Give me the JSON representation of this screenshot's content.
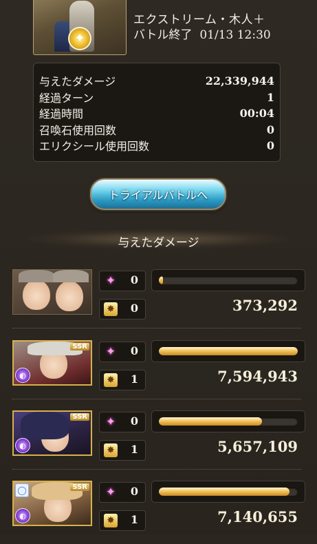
{
  "header": {
    "quest_title": "エクストリーム・木人＋",
    "battle_end_label": "バトル終了",
    "battle_end_time": "01/13 12:30",
    "boss_icon": "boss-portrait-icon",
    "element_icon": "light-element-icon"
  },
  "stats": [
    {
      "label": "与えたダメージ",
      "value": "22,339,944"
    },
    {
      "label": "経過ターン",
      "value": "1"
    },
    {
      "label": "経過時間",
      "value": "00:04"
    },
    {
      "label": "召喚石使用回数",
      "value": "0"
    },
    {
      "label": "エリクシール使用回数",
      "value": "0"
    }
  ],
  "trial_button_label": "トライアルバトルへ",
  "damage_section_title": "与えたダメージ",
  "characters": [
    {
      "skill_count": "0",
      "ca_count": "0",
      "damage": "373,292",
      "bar_fraction": 0.02,
      "rarity": "",
      "element": ""
    },
    {
      "skill_count": "0",
      "ca_count": "1",
      "damage": "7,594,943",
      "bar_fraction": 1.0,
      "rarity": "SSR",
      "element": "dark"
    },
    {
      "skill_count": "0",
      "ca_count": "1",
      "damage": "5,657,109",
      "bar_fraction": 0.745,
      "rarity": "SSR",
      "element": "dark"
    },
    {
      "skill_count": "0",
      "ca_count": "1",
      "damage": "7,140,655",
      "bar_fraction": 0.94,
      "rarity": "SSR",
      "element": "dark"
    }
  ],
  "icons": {
    "skill": "skill-sparkle-icon",
    "ca": "charge-attack-icon",
    "element": "dark-element-icon",
    "ring": "ring-icon"
  },
  "colors": {
    "bar_fill": "#f2c45e",
    "button": "#2c9bc4",
    "background": "#2b2620"
  }
}
